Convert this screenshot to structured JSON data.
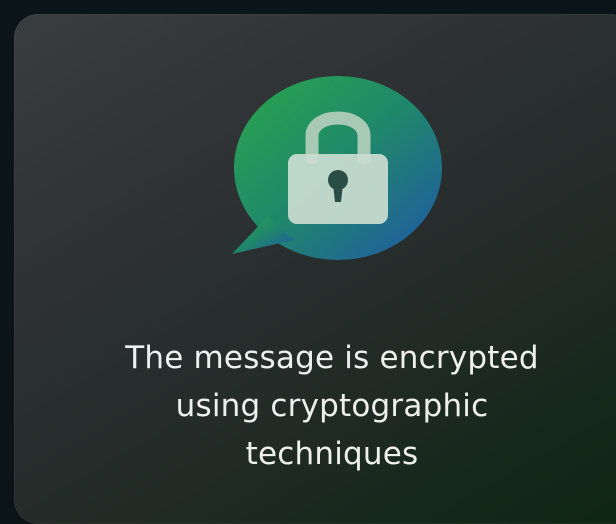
{
  "card": {
    "icon": "encrypted-chat-lock-icon",
    "message_lines": [
      "The message is encrypted",
      "using cryptographic",
      "techniques"
    ]
  },
  "colors": {
    "background": "#0b1416",
    "card_top": "#393d3f",
    "card_bottom_right": "#0f2613",
    "bubble_green": "#2aa64b",
    "bubble_blue": "#1f56a8",
    "text": "#eef0ef"
  }
}
